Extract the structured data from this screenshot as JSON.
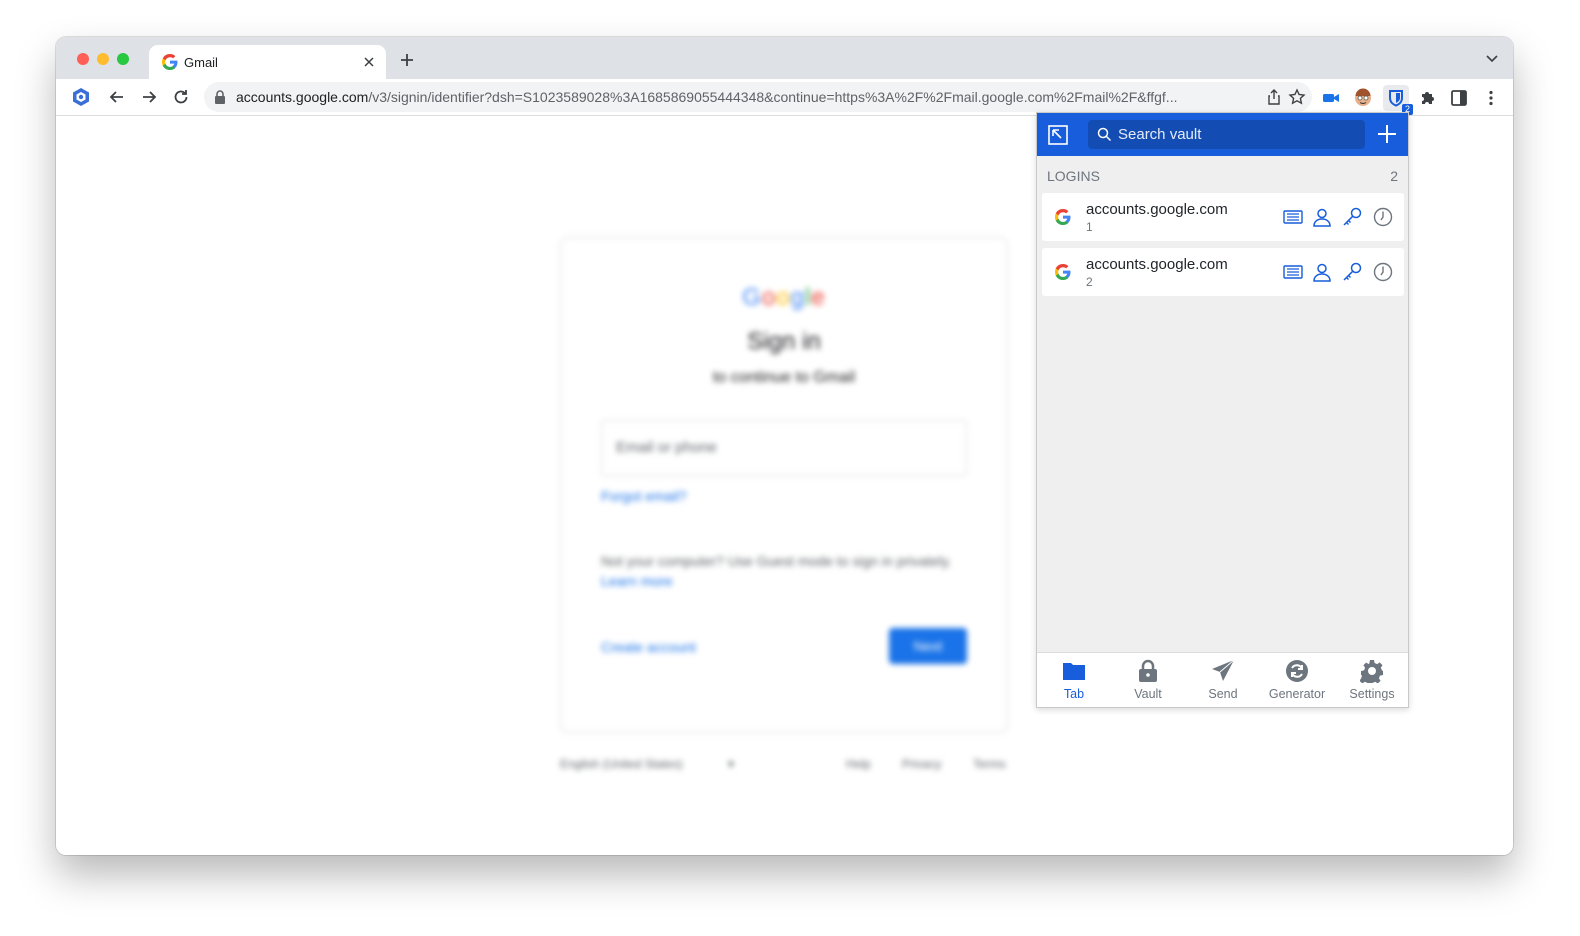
{
  "browser": {
    "tab": {
      "title": "Gmail"
    },
    "url": {
      "host": "accounts.google.com",
      "path": "/v3/signin/identifier?dsh=S1023589028%3A1685869055444348&continue=https%3A%2F%2Fmail.google.com%2Fmail%2F&ffgf..."
    },
    "extension_badge": "2"
  },
  "google_signin": {
    "logo": [
      "G",
      "o",
      "o",
      "g",
      "l",
      "e"
    ],
    "title": "Sign in",
    "subtitle": "to continue to Gmail",
    "email_placeholder": "Email or phone",
    "forgot": "Forgot email?",
    "guest_text": "Not your computer? Use Guest mode to sign in privately.",
    "learn_more": "Learn more",
    "create": "Create account",
    "next": "Next",
    "footer": {
      "language": "English (United States)",
      "help": "Help",
      "privacy": "Privacy",
      "terms": "Terms"
    }
  },
  "bitwarden": {
    "search_placeholder": "Search vault",
    "section": {
      "label": "LOGINS",
      "count": "2"
    },
    "items": [
      {
        "name": "accounts.google.com",
        "sub": "1"
      },
      {
        "name": "accounts.google.com",
        "sub": "2"
      }
    ],
    "nav": [
      {
        "label": "Tab",
        "icon": "folder-icon",
        "active": true
      },
      {
        "label": "Vault",
        "icon": "lock-icon",
        "active": false
      },
      {
        "label": "Send",
        "icon": "paper-plane-icon",
        "active": false
      },
      {
        "label": "Generator",
        "icon": "refresh-icon",
        "active": false
      },
      {
        "label": "Settings",
        "icon": "gear-icon",
        "active": false
      }
    ],
    "colors": {
      "brand": "#175ddc",
      "muted": "#6d757e"
    }
  }
}
